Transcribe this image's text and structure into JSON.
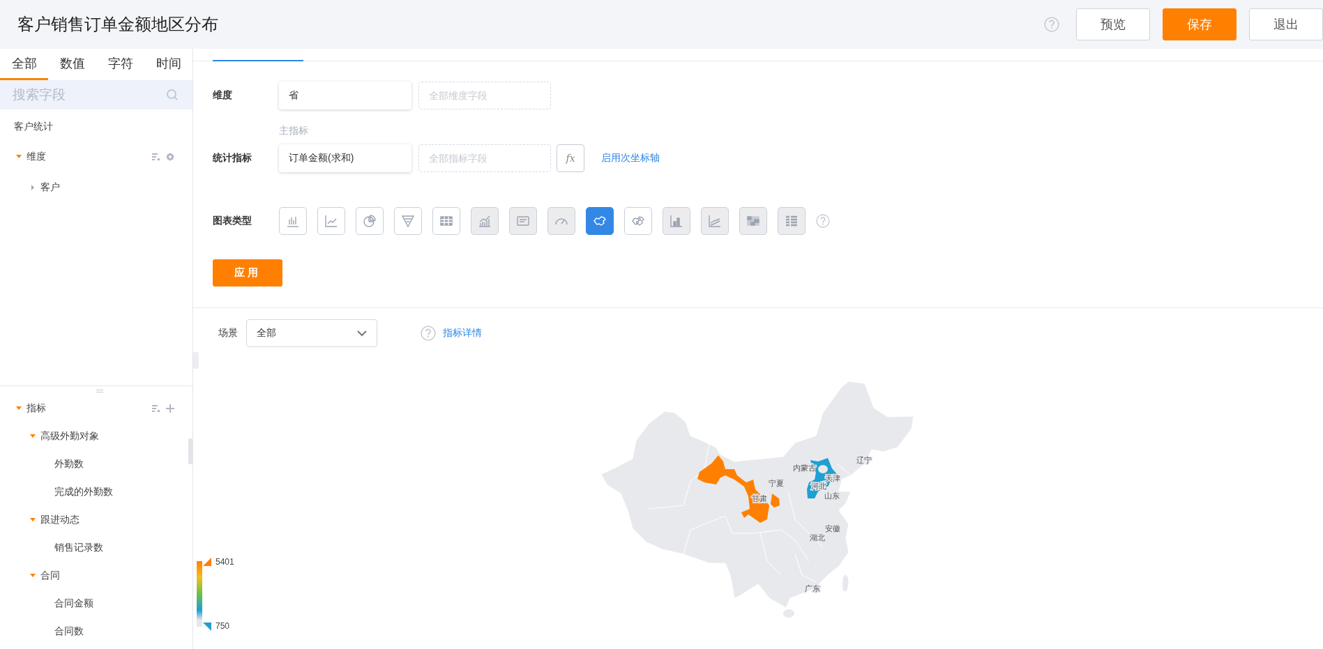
{
  "header": {
    "title": "客户销售订单金额地区分布",
    "buttons": [
      {
        "label": "预览",
        "kind": "default"
      },
      {
        "label": "保存",
        "kind": "primary"
      },
      {
        "label": "退出",
        "kind": "default"
      }
    ]
  },
  "sidebar": {
    "tabs": [
      {
        "label": "全部",
        "selected": true
      },
      {
        "label": "数值",
        "selected": false
      },
      {
        "label": "字符",
        "selected": false
      },
      {
        "label": "时间",
        "selected": false
      }
    ],
    "search": {
      "placeholder": "搜索字段"
    },
    "source": "客户统计",
    "dimensions": {
      "label": "维度",
      "expanded": true,
      "children": [
        {
          "label": "客户",
          "expanded": false
        }
      ]
    },
    "measures": {
      "label": "指标",
      "expanded": true,
      "children": [
        {
          "label": "高级外勤对象",
          "expanded": true,
          "children": [
            {
              "label": "外勤数"
            },
            {
              "label": "完成的外勤数"
            }
          ]
        },
        {
          "label": "跟进动态",
          "expanded": true,
          "children": [
            {
              "label": "销售记录数"
            }
          ]
        },
        {
          "label": "合同",
          "expanded": true,
          "children": [
            {
              "label": "合同金额"
            },
            {
              "label": "合同数"
            }
          ]
        }
      ]
    }
  },
  "config": {
    "dimension": {
      "label": "维度",
      "value": "省",
      "placeholder": "全部维度字段"
    },
    "measure": {
      "caption": "主指标",
      "label": "统计指标",
      "value": "订单金额(求和)",
      "placeholder": "全部指标字段",
      "formula": "fx",
      "link": "启用次坐标轴"
    },
    "chart_types": {
      "label": "图表类型",
      "items": [
        {
          "kind": "bar",
          "selected": false,
          "disabled": false
        },
        {
          "kind": "line",
          "selected": false,
          "disabled": false
        },
        {
          "kind": "pie",
          "selected": false,
          "disabled": false
        },
        {
          "kind": "funnel",
          "selected": false,
          "disabled": false
        },
        {
          "kind": "table",
          "selected": false,
          "disabled": false
        },
        {
          "kind": "combo",
          "selected": false,
          "disabled": true
        },
        {
          "kind": "text",
          "selected": false,
          "disabled": true
        },
        {
          "kind": "gauge",
          "selected": false,
          "disabled": true
        },
        {
          "kind": "map",
          "selected": true,
          "disabled": false
        },
        {
          "kind": "bubblemap",
          "selected": false,
          "disabled": false
        },
        {
          "kind": "column",
          "selected": false,
          "disabled": true
        },
        {
          "kind": "multiline",
          "selected": false,
          "disabled": true
        },
        {
          "kind": "heatmap",
          "selected": false,
          "disabled": true
        },
        {
          "kind": "pivot",
          "selected": false,
          "disabled": true
        }
      ]
    },
    "apply": "应用"
  },
  "preview": {
    "scene": {
      "label": "场景",
      "value": "全部"
    },
    "detail_link": "指标详情",
    "map": {
      "areas": [
        {
          "label": "甘肃",
          "color": "#ff8000"
        },
        {
          "label": "河北",
          "color": "#1ea0d2"
        }
      ],
      "labels": [
        "内蒙古",
        "辽宁",
        "天津",
        "宁夏",
        "山东",
        "安徽",
        "湖北",
        "广东"
      ],
      "legend": {
        "max": "5401",
        "min": "750"
      }
    }
  }
}
